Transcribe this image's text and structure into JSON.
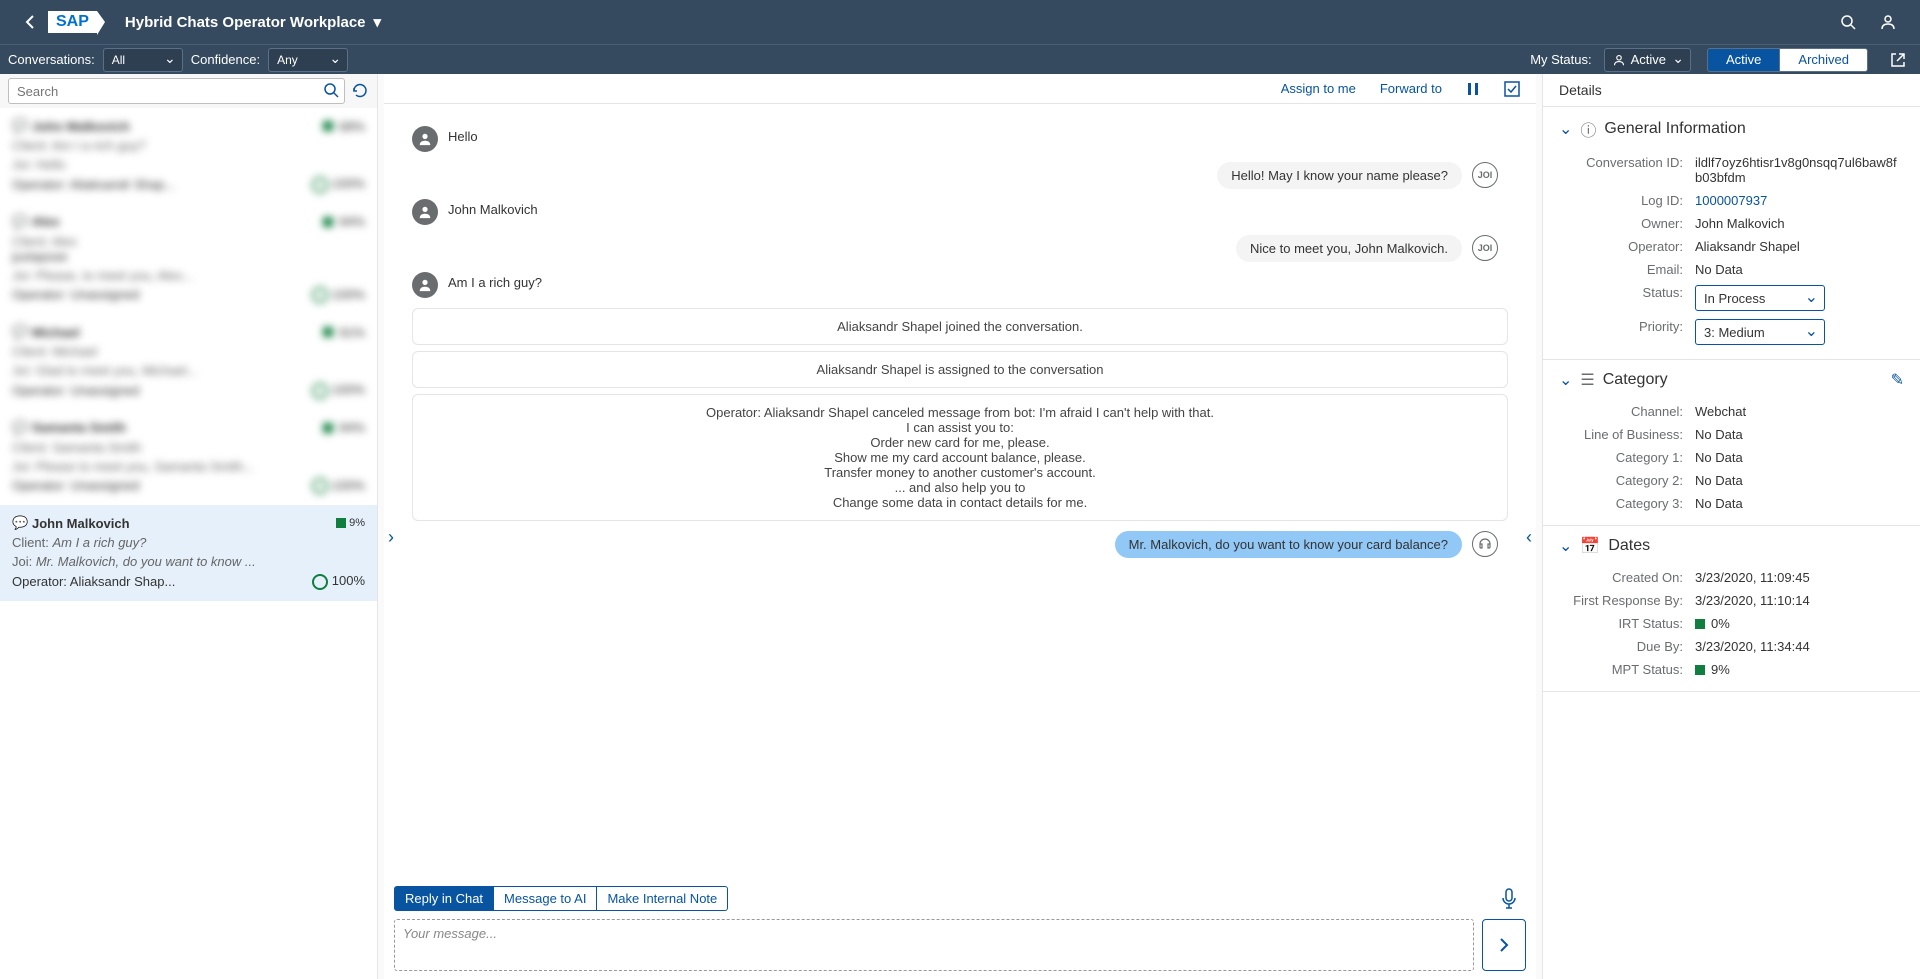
{
  "header": {
    "logo": "SAP",
    "title": "Hybrid Chats Operator Workplace"
  },
  "toolbar": {
    "conversations_label": "Conversations:",
    "conversations_value": "All",
    "confidence_label": "Confidence:",
    "confidence_value": "Any",
    "status_label": "My Status:",
    "status_value": "Active",
    "tab_active": "Active",
    "tab_archived": "Archived"
  },
  "sidebar": {
    "search_placeholder": "Search",
    "blurred": [
      {
        "name": "John Malkovich",
        "l1": "Client: Am I a rich guy?",
        "l2": "Joi: Hello",
        "op": "Operator: Aliaksandr Shap...",
        "pct": "68%"
      },
      {
        "name": "Alex",
        "l1": "Client: Alex",
        "l2": "Joi: Please, to meet you, Alex...",
        "op": "Operator: Unassigned",
        "pct": "94%"
      },
      {
        "name": "Michael",
        "l1": "Client: Michael",
        "l2": "Joi: Glad to meet you, Michael...",
        "op": "Operator: Unassigned",
        "pct": "91%"
      },
      {
        "name": "Samanta Smith",
        "l1": "Client: Samanta Smith",
        "l2": "Joi: Please to meet you, Samanta Smith...",
        "op": "Operator: Unassigned",
        "pct": "94%"
      }
    ],
    "selected": {
      "name": "John Malkovich",
      "badge": "9%",
      "line1_label": "Client: ",
      "line1_msg": "Am I a rich guy?",
      "line2_label": "Joi: ",
      "line2_msg": "Mr. Malkovich, do you want to know ...",
      "operator": "Operator: Aliaksandr Shap...",
      "confidence": "100%"
    }
  },
  "chat": {
    "assign_label": "Assign to me",
    "forward_label": "Forward to",
    "messages": {
      "m1": "Hello",
      "m2": "Hello! May I know your name please?",
      "m3": "John Malkovich",
      "m4": "Nice to meet you, John Malkovich.",
      "m5": "Am I a rich guy?",
      "sys1": "Aliaksandr Shapel joined the conversation.",
      "sys2": "Aliaksandr Shapel is assigned to the conversation",
      "sys3": "Operator: Aliaksandr Shapel canceled message from bot: I'm afraid I can't help with that.\nI can assist you to:\nOrder new card for me, please.\nShow me my card account balance, please.\nTransfer money to another customer's account.\n... and also help you to\nChange some data in contact details for me.",
      "m6": "Mr. Malkovich, do you want to know your card balance?"
    },
    "tabs": {
      "reply": "Reply in Chat",
      "message_ai": "Message to AI",
      "note": "Make Internal Note"
    },
    "input_placeholder": "Your message..."
  },
  "details": {
    "title": "Details",
    "sections": {
      "general": {
        "title": "General Information",
        "rows": {
          "conversation_id_label": "Conversation ID:",
          "conversation_id": "ildlf7oyz6htisr1v8g0nsqq7ul6baw8fb03bfdm",
          "log_id_label": "Log ID:",
          "log_id": "1000007937",
          "owner_label": "Owner:",
          "owner": "John Malkovich",
          "operator_label": "Operator:",
          "operator": "Aliaksandr Shapel",
          "email_label": "Email:",
          "email": "No Data",
          "status_label": "Status:",
          "status": "In Process",
          "priority_label": "Priority:",
          "priority": "3: Medium"
        }
      },
      "category": {
        "title": "Category",
        "rows": {
          "channel_label": "Channel:",
          "channel": "Webchat",
          "lob_label": "Line of Business:",
          "lob": "No Data",
          "cat1_label": "Category 1:",
          "cat1": "No Data",
          "cat2_label": "Category 2:",
          "cat2": "No Data",
          "cat3_label": "Category 3:",
          "cat3": "No Data"
        }
      },
      "dates": {
        "title": "Dates",
        "rows": {
          "created_label": "Created On:",
          "created": "3/23/2020, 11:09:45",
          "first_label": "First Response By:",
          "first": "3/23/2020, 11:10:14",
          "irt_label": "IRT Status:",
          "irt": "0%",
          "due_label": "Due By:",
          "due": "3/23/2020, 11:34:44",
          "mpt_label": "MPT Status:",
          "mpt": "9%"
        }
      }
    }
  }
}
